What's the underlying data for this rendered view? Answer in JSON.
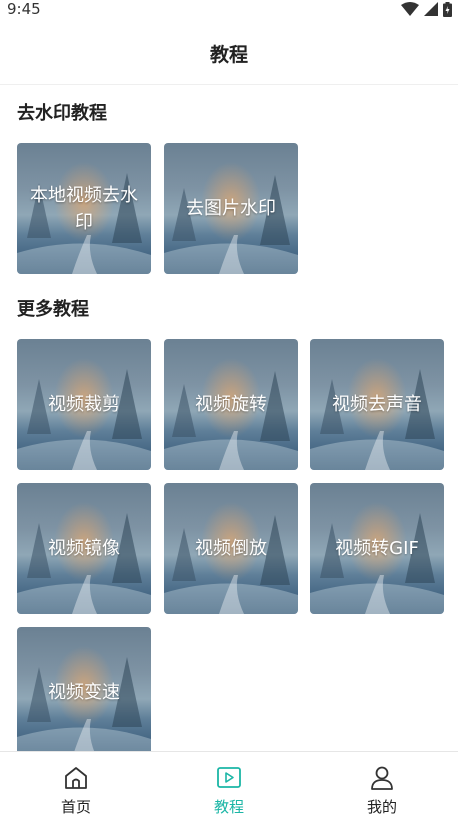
{
  "status": {
    "time": "9:45"
  },
  "header": {
    "title": "教程"
  },
  "sections": {
    "watermark": {
      "title": "去水印教程",
      "cards": [
        {
          "label": "本地视频去水印"
        },
        {
          "label": "去图片水印"
        }
      ]
    },
    "more": {
      "title": "更多教程",
      "cards": [
        {
          "label": "视频裁剪"
        },
        {
          "label": "视频旋转"
        },
        {
          "label": "视频去声音"
        },
        {
          "label": "视频镜像"
        },
        {
          "label": "视频倒放"
        },
        {
          "label": "视频转GIF"
        },
        {
          "label": "视频变速"
        }
      ]
    }
  },
  "tabbar": {
    "items": [
      {
        "label": "首页",
        "icon": "home-icon"
      },
      {
        "label": "教程",
        "icon": "play-icon"
      },
      {
        "label": "我的",
        "icon": "user-icon"
      }
    ],
    "active_color": "#1bb6a6"
  }
}
